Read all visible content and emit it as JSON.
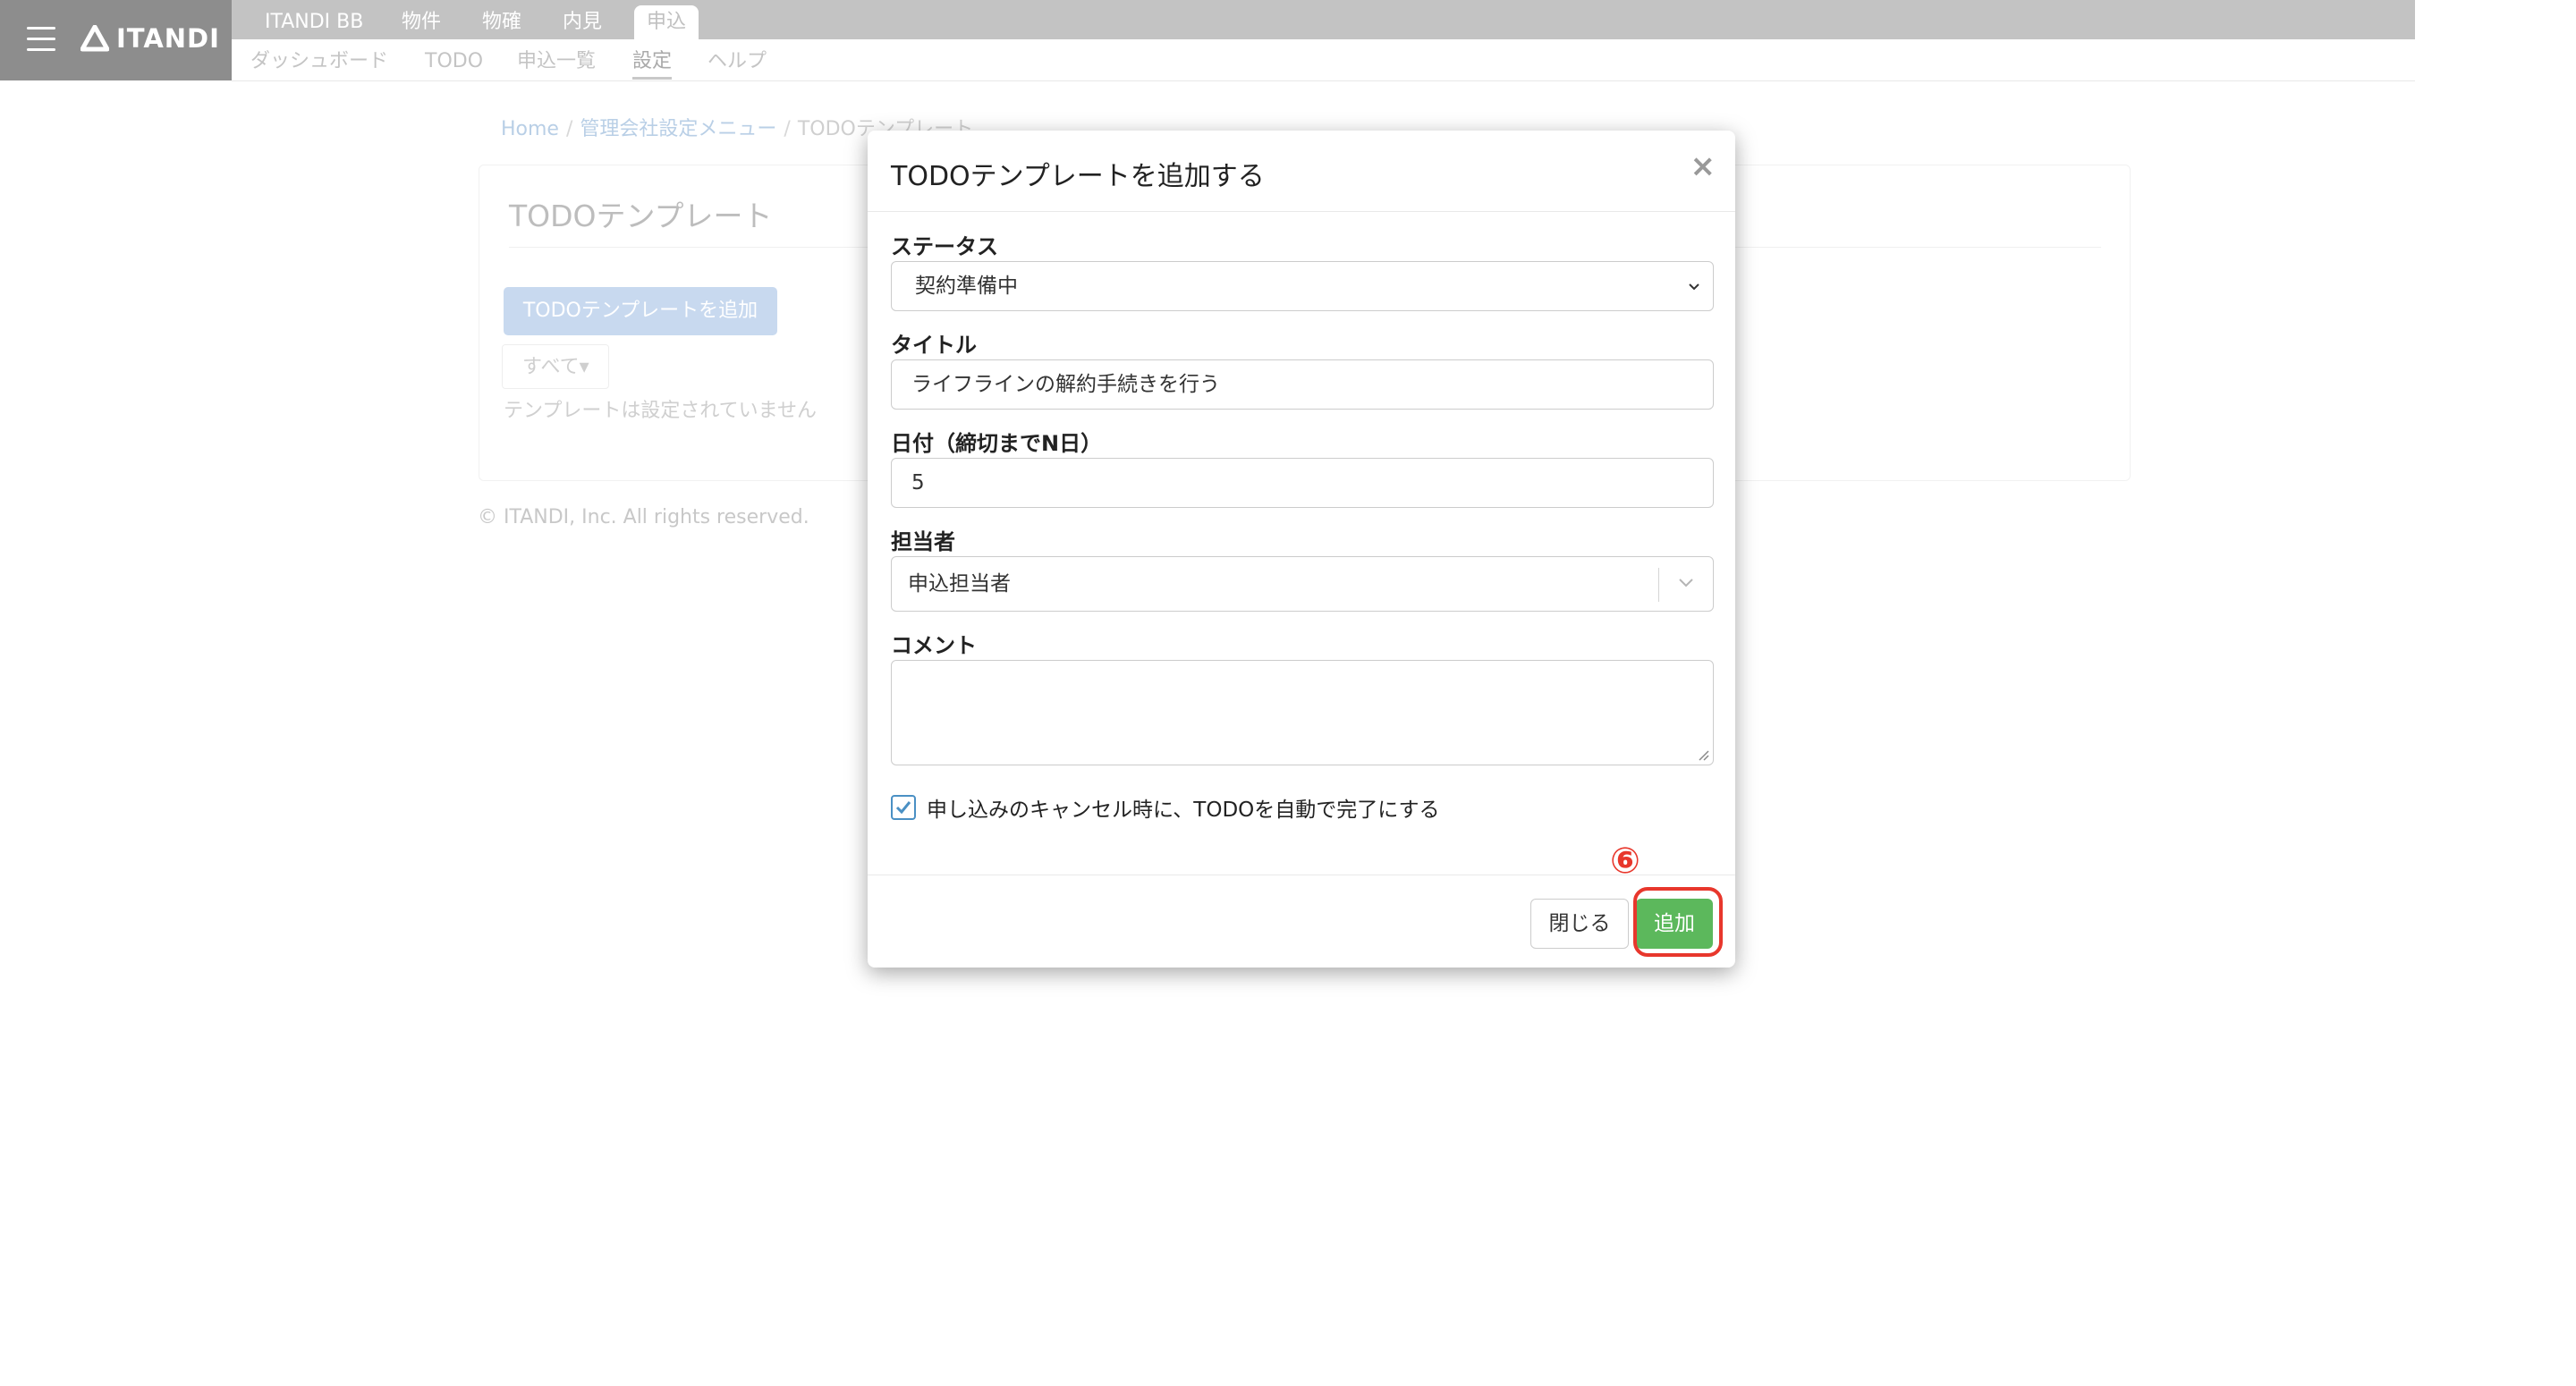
{
  "header": {
    "brand": "ITANDI",
    "nav_tabs": [
      {
        "label": "ITANDI BB",
        "active": false
      },
      {
        "label": "物件",
        "active": false
      },
      {
        "label": "物確",
        "active": false
      },
      {
        "label": "内見",
        "active": false
      },
      {
        "label": "申込",
        "active": true
      }
    ],
    "sub_nav": [
      {
        "label": "ダッシュボード",
        "active": false
      },
      {
        "label": "TODO",
        "active": false
      },
      {
        "label": "申込一覧",
        "active": false
      },
      {
        "label": "設定",
        "active": true
      },
      {
        "label": "ヘルプ",
        "active": false
      }
    ]
  },
  "breadcrumb": [
    "Home",
    "管理会社設定メニュー",
    "TODOテンプレート"
  ],
  "page": {
    "title": "TODOテンプレート",
    "add_button": "TODOテンプレートを追加",
    "filter": "すべて▾",
    "empty_message": "テンプレートは設定されていません"
  },
  "footer": "© ITANDI, Inc. All rights reserved.",
  "modal": {
    "title": "TODOテンプレートを追加する",
    "close_symbol": "×",
    "status_label": "ステータス",
    "status_value": "契約準備中",
    "title_label": "タイトル",
    "title_value": "ライフラインの解約手続きを行う",
    "date_label": "日付（締切までN日）",
    "date_value": "5",
    "assignee_label": "担当者",
    "assignee_value": "申込担当者",
    "comment_label": "コメント",
    "comment_value": "",
    "auto_complete_label": "申し込みのキャンセル時に、TODOを自動で完了にする",
    "auto_complete_checked": true,
    "close_button": "閉じる",
    "add_button": "追加"
  },
  "annotation": {
    "step": "⑥",
    "color": "#e8372c"
  }
}
